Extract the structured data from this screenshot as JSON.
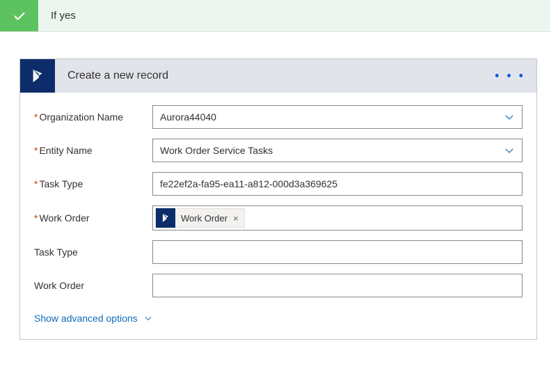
{
  "outer_header": {
    "title": "If yes"
  },
  "card": {
    "title": "Create a new record",
    "fields": {
      "org_name": {
        "label": "Organization Name",
        "value": "Aurora44040",
        "required": true,
        "type": "select"
      },
      "entity_name": {
        "label": "Entity Name",
        "value": "Work Order Service Tasks",
        "required": true,
        "type": "select"
      },
      "task_type_req": {
        "label": "Task Type",
        "value": "fe22ef2a-fa95-ea11-a812-000d3a369625",
        "required": true,
        "type": "text"
      },
      "work_order_req": {
        "label": "Work Order",
        "required": true,
        "type": "token",
        "token_label": "Work Order"
      },
      "task_type_opt": {
        "label": "Task Type",
        "value": "",
        "required": false,
        "type": "text"
      },
      "work_order_opt": {
        "label": "Work Order",
        "value": "",
        "required": false,
        "type": "text"
      }
    },
    "advanced_link": "Show advanced options"
  },
  "colors": {
    "green": "#5dc360",
    "green_bg": "#edf6ee",
    "navy": "#0c2d6a",
    "header_bg": "#e2e4eb",
    "blue": "#0f6cbd"
  }
}
